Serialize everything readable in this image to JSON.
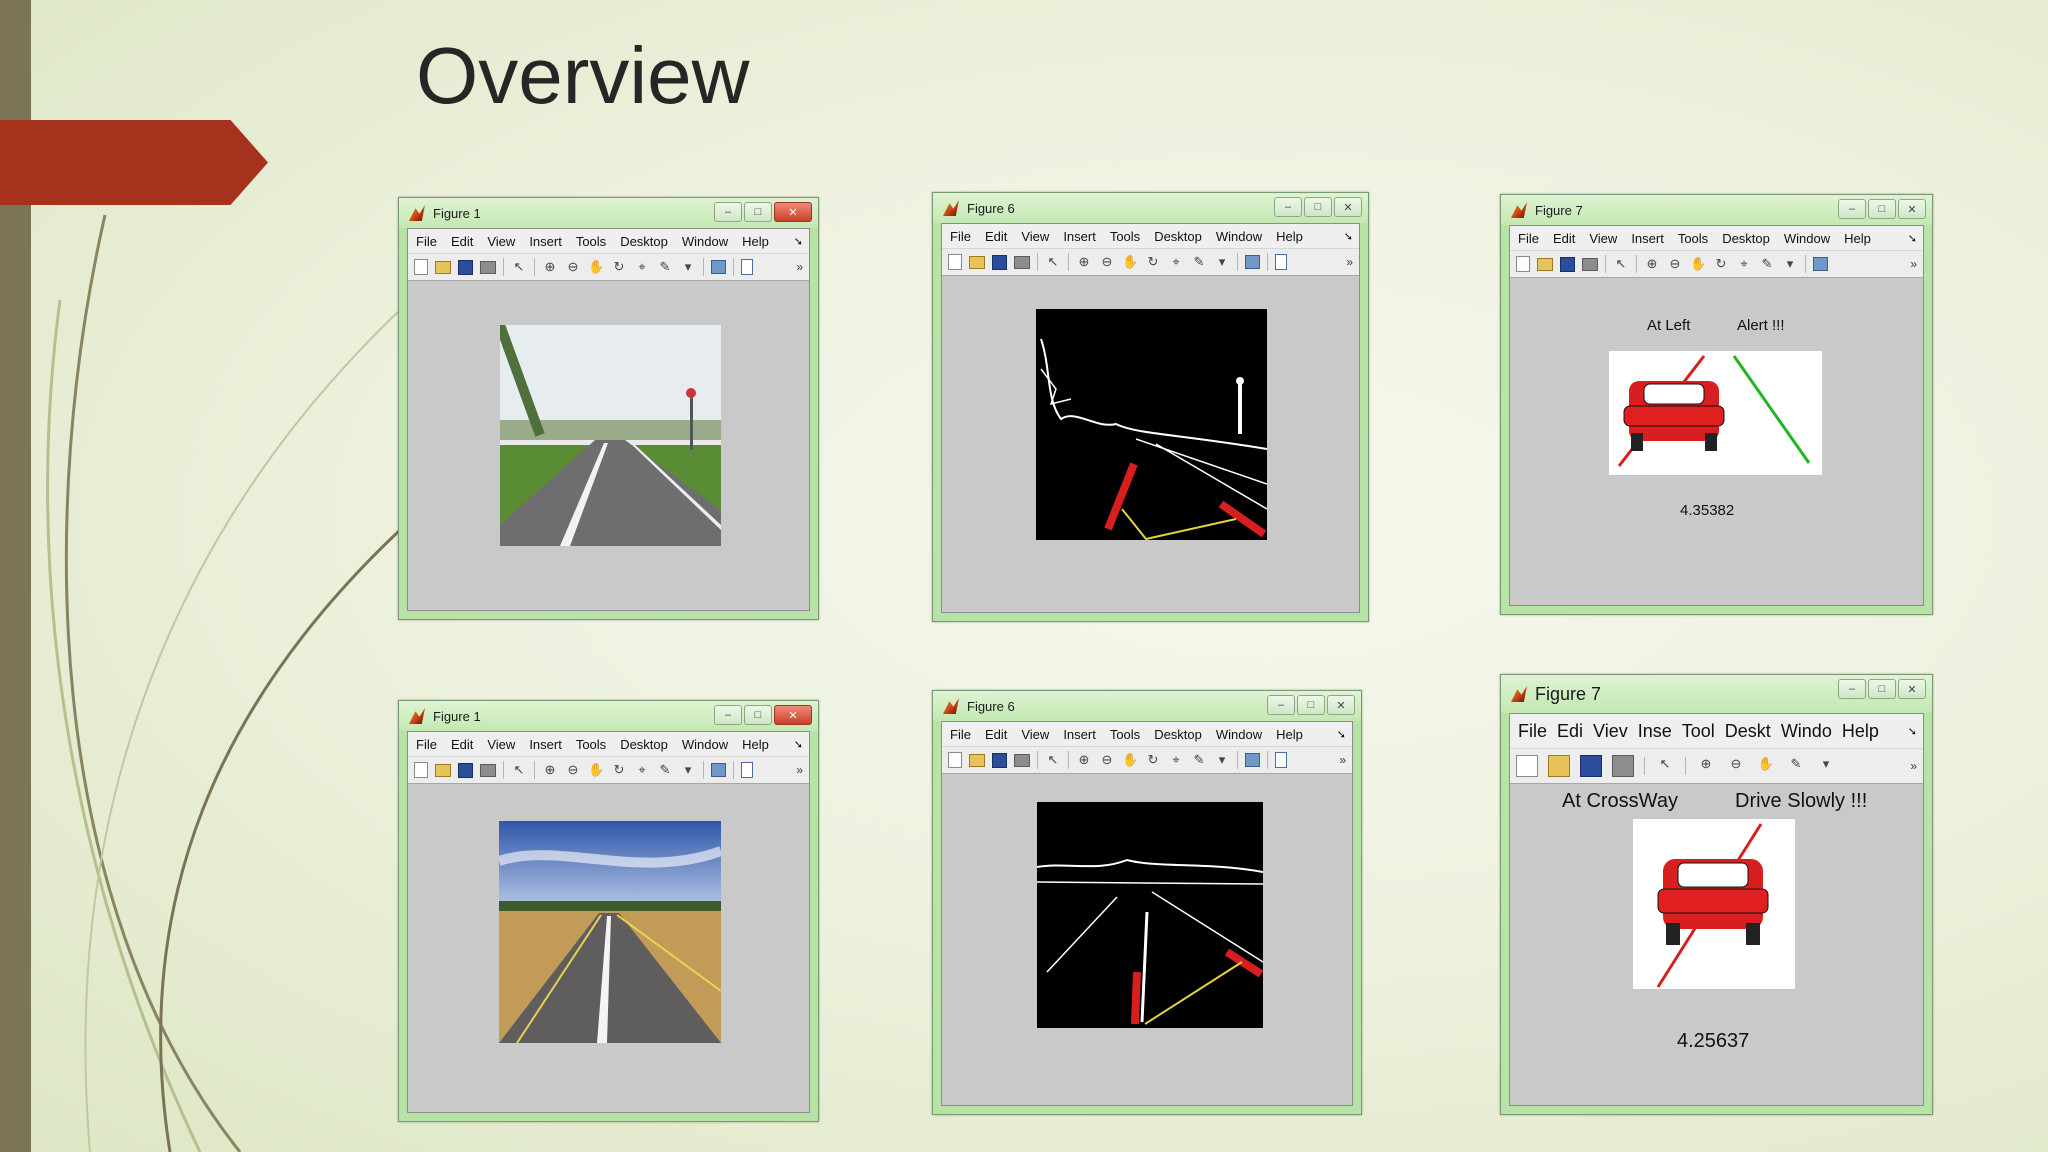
{
  "slide": {
    "title": "Overview"
  },
  "menu": [
    "File",
    "Edit",
    "View",
    "Insert",
    "Tools",
    "Desktop",
    "Window",
    "Help"
  ],
  "menu_truncated": [
    "File",
    "Edi",
    "Viev",
    "Inse",
    "Tool",
    "Deskt",
    "Windo",
    "Help"
  ],
  "windows": {
    "w1": {
      "title": "Figure 1"
    },
    "w2": {
      "title": "Figure 6"
    },
    "w3": {
      "title": "Figure 7",
      "label_left": "At Left",
      "label_right": "Alert !!!",
      "value": "4.35382"
    },
    "w4": {
      "title": "Figure 1"
    },
    "w5": {
      "title": "Figure 6"
    },
    "w6": {
      "title": "Figure 7",
      "label_left": "At CrossWay",
      "label_right": "Drive Slowly !!!",
      "value": "4.25637"
    }
  },
  "icons": [
    "new-file-icon",
    "open-folder-icon",
    "save-icon",
    "print-icon",
    "pointer-icon",
    "zoom-in-icon",
    "zoom-out-icon",
    "pan-icon",
    "rotate-icon",
    "data-cursor-icon",
    "brush-icon",
    "dropdown-icon",
    "link-icon",
    "insert-colorbar-icon"
  ],
  "colors": {
    "accent": "#a6311d",
    "window_frame": "#b7e4a6",
    "lane_red": "#d81e1e",
    "lane_yellow": "#e5d23b",
    "lane_green": "#22b422"
  }
}
